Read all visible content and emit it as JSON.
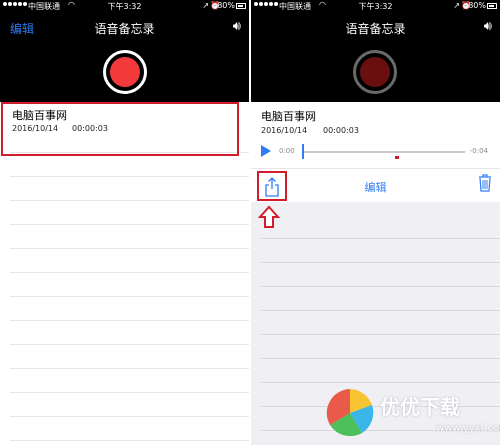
{
  "status_bar": {
    "carrier": "中国联通",
    "time": "下午3:32",
    "battery": "80%"
  },
  "nav": {
    "edit": "编辑",
    "title": "语音备忘录"
  },
  "recording": {
    "name": "电脑百事网",
    "date": "2016/10/14",
    "duration": "00:00:03"
  },
  "player": {
    "current_time": "0:00",
    "remaining_time": "-0:04",
    "progress": 0.0
  },
  "toolbar": {
    "edit": "编辑"
  },
  "watermark": {
    "text": "优优下载",
    "url": "www.yyxt.com"
  },
  "colors": {
    "accent": "#2f7cf6",
    "record_red": "#f33a3a",
    "highlight_red": "#d11d2b"
  }
}
